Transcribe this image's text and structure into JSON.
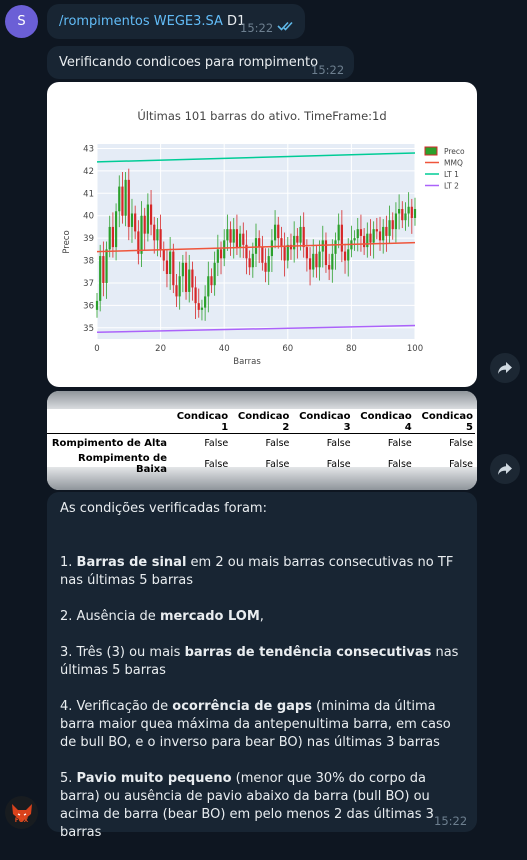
{
  "chat": {
    "user_avatar_letter": "S",
    "command_message": {
      "command": "/rompimentos WEGE3.SA",
      "args": " D1",
      "time": "15:22",
      "status": "read"
    },
    "status_message": {
      "text": "Verificando condicoes para rompimento",
      "time": "15:22"
    },
    "conditions_message": {
      "intro": "As condições verificadas foram:",
      "items": [
        {
          "num": "1.",
          "before": "",
          "bold": "Barras de sinal",
          "after": " em 2 ou mais barras consecutivas no TF nas últimas 5 barras"
        },
        {
          "num": "2.",
          "before": "Ausência de ",
          "bold": "mercado LOM",
          "after": ","
        },
        {
          "num": "3.",
          "before": "Três (3) ou mais ",
          "bold": "barras de tendência consecutivas",
          "after": " nas últimas 5 barras"
        },
        {
          "num": "4.",
          "before": "Verificação de ",
          "bold": "ocorrência de gaps",
          "after": " (minima da última barra maior quea máxima da antepenultima barra, em caso de bull BO, e o inverso para bear BO) nas últimas 3 barras"
        },
        {
          "num": "5.",
          "before": "",
          "bold": "Pavio muito pequeno",
          "after": " (menor que 30% do corpo da barra) ou ausência de pavio  abaixo da barra (bull BO) ou acima de barra (bear BO) em pelo menos 2 das últimas 3 barras"
        }
      ],
      "time": "15:22"
    },
    "bot_avatar_label": "FOX"
  },
  "table": {
    "headers": [
      "",
      "Condicao 1",
      "Condicao 2",
      "Condicao 3",
      "Condicao 4",
      "Condicao 5"
    ],
    "rows": [
      {
        "label": "Rompimento de Alta",
        "values": [
          "False",
          "False",
          "False",
          "False",
          "False"
        ]
      },
      {
        "label": "Rompimento de Baixa",
        "values": [
          "False",
          "False",
          "False",
          "False",
          "False"
        ]
      }
    ]
  },
  "chart_data": {
    "type": "candlestick",
    "title": "Últimas 101 barras do ativo. TimeFrame:1d",
    "xlabel": "Barras",
    "ylabel": "Preco",
    "xlim": [
      0,
      100
    ],
    "ylim": [
      34.5,
      43.2
    ],
    "xticks": [
      0,
      20,
      40,
      60,
      80,
      100
    ],
    "yticks": [
      35,
      36,
      37,
      38,
      39,
      40,
      41,
      42,
      43
    ],
    "grid": true,
    "legend_position": "top-right",
    "series": [
      {
        "name": "Preco",
        "kind": "candles",
        "up_color": "#2ca02c",
        "down_color": "#d62728",
        "close": [
          36.2,
          38.2,
          37.0,
          38.5,
          39.5,
          38.6,
          40.2,
          41.3,
          40.0,
          41.6,
          39.5,
          40.1,
          39.3,
          38.3,
          40.0,
          39.2,
          40.5,
          39.6,
          38.9,
          39.4,
          38.5,
          38.0,
          37.4,
          38.4,
          36.9,
          36.4,
          37.3,
          37.9,
          36.6,
          37.6,
          36.8,
          36.1,
          35.8,
          35.9,
          36.4,
          37.3,
          36.9,
          37.9,
          38.5,
          38.1,
          38.9,
          39.4,
          38.8,
          39.4,
          38.6,
          39.2,
          38.7,
          38.1,
          37.7,
          38.3,
          39.0,
          38.6,
          37.9,
          37.5,
          38.2,
          38.9,
          39.6,
          39.0,
          38.6,
          38.0,
          38.7,
          38.5,
          39.1,
          38.8,
          39.5,
          38.6,
          38.1,
          37.6,
          38.3,
          37.7,
          38.4,
          38.9,
          37.8,
          37.6,
          38.3,
          38.9,
          39.6,
          38.4,
          38.0,
          38.5,
          38.9,
          39.0,
          39.4,
          39.1,
          38.6,
          39.2,
          38.8,
          39.4,
          39.3,
          38.9,
          39.5,
          39.1,
          39.8,
          39.4,
          40.1,
          40.3,
          39.8,
          40.1,
          40.4,
          39.9,
          40.3
        ]
      },
      {
        "name": "MMQ",
        "kind": "line",
        "color": "#ef553b",
        "values": [
          38.4,
          38.8
        ]
      },
      {
        "name": "LT 1",
        "kind": "line",
        "color": "#00cc96",
        "values": [
          42.4,
          42.8
        ]
      },
      {
        "name": "LT 2",
        "kind": "line",
        "color": "#ab63fa",
        "values": [
          34.8,
          35.1
        ]
      }
    ]
  }
}
